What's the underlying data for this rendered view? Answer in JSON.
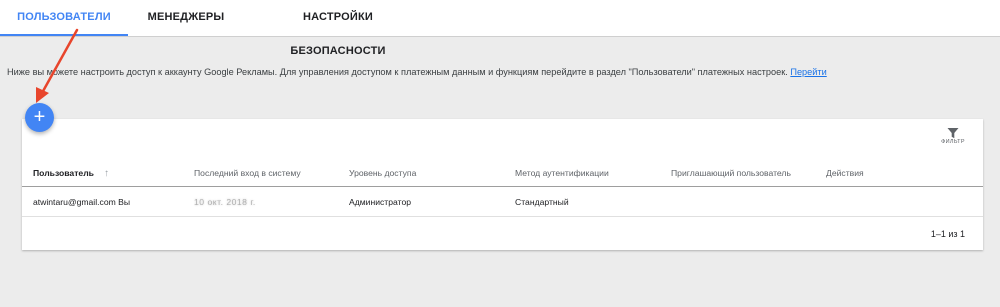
{
  "tabs": [
    {
      "label": "ПОЛЬЗОВАТЕЛИ",
      "active": true
    },
    {
      "label": "МЕНЕДЖЕРЫ",
      "active": false
    },
    {
      "label": "НАСТРОЙКИ БЕЗОПАСНОСТИ",
      "active": false
    }
  ],
  "info": {
    "text": "Ниже вы можете настроить доступ к аккаунту Google Рекламы. Для управления доступом к платежным данным и функциям перейдите в раздел \"Пользователи\" платежных настроек.",
    "link": "Перейти"
  },
  "fab": {
    "symbol": "+"
  },
  "filter": {
    "label": "ФИЛЬТР",
    "icon": "filter-icon"
  },
  "table": {
    "columns": [
      "Пользователь",
      "Последний вход в систему",
      "Уровень доступа",
      "Метод аутентификации",
      "Приглашающий пользователь",
      "Действия"
    ],
    "rows": [
      {
        "user": "atwintaru@gmail.com Вы",
        "last_login": "10 окт. 2018 г.",
        "access": "Администратор",
        "auth": "Стандартный",
        "inviter": "",
        "actions": ""
      }
    ]
  },
  "pager": {
    "text": "1–1 из 1"
  },
  "colors": {
    "accent": "#4285f4",
    "annotation_arrow": "#e8452c"
  }
}
